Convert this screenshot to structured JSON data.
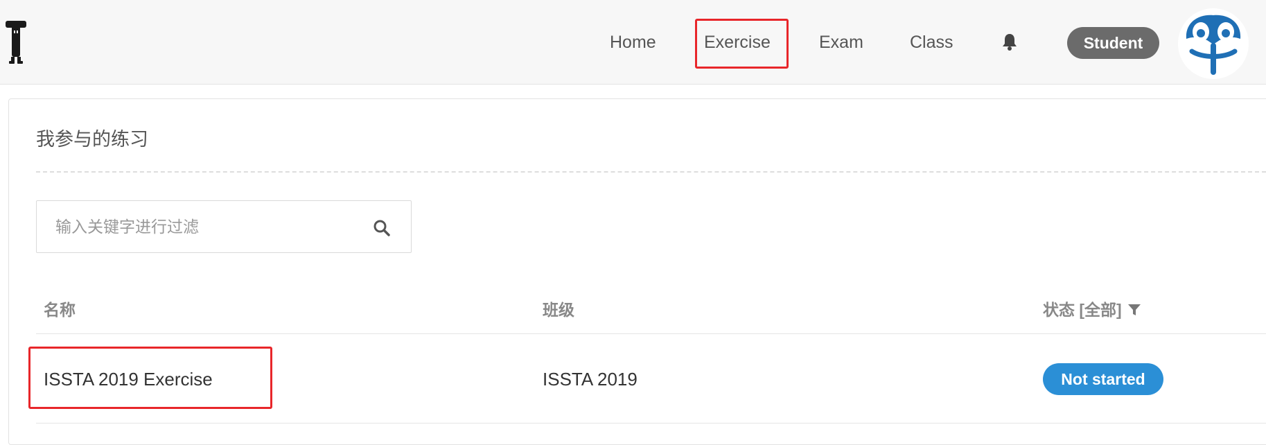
{
  "navbar": {
    "links": {
      "home": "Home",
      "exercise": "Exercise",
      "exam": "Exam",
      "class": "Class"
    },
    "role_badge": "Student"
  },
  "page": {
    "title": "我参与的练习"
  },
  "search": {
    "placeholder": "输入关键字进行过滤",
    "value": ""
  },
  "table": {
    "headers": {
      "name": "名称",
      "class": "班级",
      "status": "状态 [全部]"
    },
    "rows": [
      {
        "name": "ISSTA 2019 Exercise",
        "class": "ISSTA 2019",
        "status": "Not started"
      }
    ]
  },
  "colors": {
    "highlight": "#e8262a",
    "status_blue": "#2b8fd6",
    "badge_gray": "#6b6b6b",
    "navbar_bg": "#f7f7f7"
  },
  "icons": {
    "logo": "t-mascot-logo",
    "bell": "bell-icon",
    "avatar": "mascot-avatar",
    "search": "search-icon",
    "filter": "filter-icon"
  }
}
